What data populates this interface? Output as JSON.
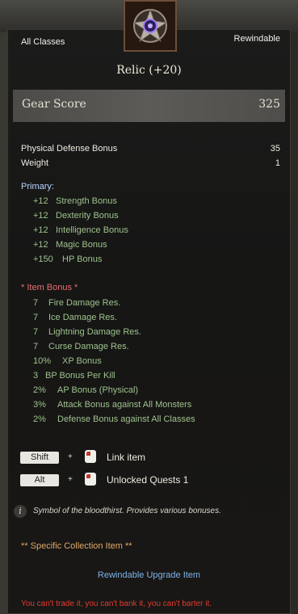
{
  "header": {
    "class_restriction": "All Classes",
    "rewindable": "Rewindable",
    "item_name": "Relic (+20)"
  },
  "gear_score": {
    "label": "Gear Score",
    "value": "325"
  },
  "stats": [
    {
      "label": "Physical Defense Bonus",
      "value": "35"
    },
    {
      "label": "Weight",
      "value": "1"
    }
  ],
  "primary": {
    "title": "Primary:",
    "items": [
      {
        "value": "+12",
        "label": "Strength Bonus"
      },
      {
        "value": "+12",
        "label": "Dexterity Bonus"
      },
      {
        "value": "+12",
        "label": "Intelligence Bonus"
      },
      {
        "value": "+12",
        "label": "Magic Bonus"
      },
      {
        "value": "+150",
        "label": "HP Bonus"
      }
    ]
  },
  "item_bonus": {
    "title": "*  Item Bonus *",
    "items": [
      {
        "value": "7",
        "label": "Fire Damage Res."
      },
      {
        "value": "7",
        "label": "Ice Damage Res."
      },
      {
        "value": "7",
        "label": "Lightning Damage Res."
      },
      {
        "value": "7",
        "label": "Curse Damage Res."
      },
      {
        "value": "10%",
        "label": "XP Bonus"
      },
      {
        "value": "3",
        "label": "BP Bonus Per Kill"
      },
      {
        "value": "2%",
        "label": "AP Bonus (Physical)"
      },
      {
        "value": "3%",
        "label": "Attack Bonus against All Monsters"
      },
      {
        "value": "2%",
        "label": "Defense Bonus against All Classes"
      }
    ]
  },
  "shortcuts": [
    {
      "key": "Shift",
      "plus": "+",
      "action": "Link item"
    },
    {
      "key": "Alt",
      "plus": "+",
      "action": "Unlocked Quests 1"
    }
  ],
  "description": "Symbol of the bloodthirst. Provides various bonuses.",
  "info_icon": "i",
  "collection": "** Specific Collection Item **",
  "upgrade": "Rewindable Upgrade Item",
  "restriction": "You can't trade it, you can't bank it, you can't barter it.",
  "icons": {
    "item": "relic-emblem-icon",
    "info": "info-icon",
    "mouse": "mouse-left-click-icon"
  },
  "colors": {
    "stat_green": "#9ec28c",
    "label_blue": "#b6d4ff",
    "bonus_pink": "#e56e6e",
    "collection_orange": "#e0a86a",
    "upgrade_blue": "#7fb3ea",
    "restriction_red": "#e63a2f"
  }
}
